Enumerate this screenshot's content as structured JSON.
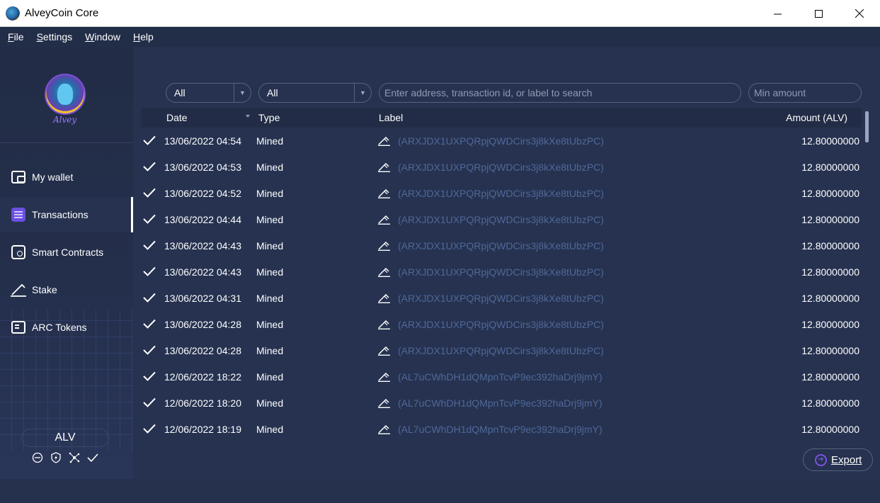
{
  "window": {
    "title": "AlveyCoin Core",
    "minimize": "—",
    "maximize": "☐",
    "close": "✕"
  },
  "menu": [
    "File",
    "Settings",
    "Window",
    "Help"
  ],
  "menu_mnemonics": [
    "F",
    "S",
    "W",
    "H"
  ],
  "sidebar": {
    "logo_text": "Alvey",
    "items": [
      {
        "label": "My wallet",
        "icon": "wallet-icon",
        "active": false
      },
      {
        "label": "Transactions",
        "icon": "transactions-icon",
        "active": true
      },
      {
        "label": "Smart Contracts",
        "icon": "smart-contracts-icon",
        "active": false
      },
      {
        "label": "Stake",
        "icon": "stake-icon",
        "active": false
      },
      {
        "label": "ARC Tokens",
        "icon": "arc-tokens-icon",
        "active": false
      }
    ],
    "unit": "ALV",
    "status_icons": [
      "hd-disabled-icon",
      "staking-icon",
      "network-icon",
      "synced-check-icon"
    ]
  },
  "filters": {
    "date_filter": "All",
    "type_filter": "All",
    "search_placeholder": "Enter address, transaction id, or label to search",
    "min_amount_placeholder": "Min amount"
  },
  "table": {
    "columns": [
      "Date",
      "Type",
      "Label",
      "Amount (ALV)"
    ],
    "rows": [
      {
        "date": "13/06/2022 04:54",
        "type": "Mined",
        "label": "(ARXJDX1UXPQRpjQWDCirs3j8kXe8tUbzPC)",
        "amount": "12.80000000"
      },
      {
        "date": "13/06/2022 04:53",
        "type": "Mined",
        "label": "(ARXJDX1UXPQRpjQWDCirs3j8kXe8tUbzPC)",
        "amount": "12.80000000"
      },
      {
        "date": "13/06/2022 04:52",
        "type": "Mined",
        "label": "(ARXJDX1UXPQRpjQWDCirs3j8kXe8tUbzPC)",
        "amount": "12.80000000"
      },
      {
        "date": "13/06/2022 04:44",
        "type": "Mined",
        "label": "(ARXJDX1UXPQRpjQWDCirs3j8kXe8tUbzPC)",
        "amount": "12.80000000"
      },
      {
        "date": "13/06/2022 04:43",
        "type": "Mined",
        "label": "(ARXJDX1UXPQRpjQWDCirs3j8kXe8tUbzPC)",
        "amount": "12.80000000"
      },
      {
        "date": "13/06/2022 04:43",
        "type": "Mined",
        "label": "(ARXJDX1UXPQRpjQWDCirs3j8kXe8tUbzPC)",
        "amount": "12.80000000"
      },
      {
        "date": "13/06/2022 04:31",
        "type": "Mined",
        "label": "(ARXJDX1UXPQRpjQWDCirs3j8kXe8tUbzPC)",
        "amount": "12.80000000"
      },
      {
        "date": "13/06/2022 04:28",
        "type": "Mined",
        "label": "(ARXJDX1UXPQRpjQWDCirs3j8kXe8tUbzPC)",
        "amount": "12.80000000"
      },
      {
        "date": "13/06/2022 04:28",
        "type": "Mined",
        "label": "(ARXJDX1UXPQRpjQWDCirs3j8kXe8tUbzPC)",
        "amount": "12.80000000"
      },
      {
        "date": "12/06/2022 18:22",
        "type": "Mined",
        "label": "(AL7uCWhDH1dQMpnTcvP9ec392haDrj9jmY)",
        "amount": "12.80000000"
      },
      {
        "date": "12/06/2022 18:20",
        "type": "Mined",
        "label": "(AL7uCWhDH1dQMpnTcvP9ec392haDrj9jmY)",
        "amount": "12.80000000"
      },
      {
        "date": "12/06/2022 18:19",
        "type": "Mined",
        "label": "(AL7uCWhDH1dQMpnTcvP9ec392haDrj9jmY)",
        "amount": "12.80000000"
      }
    ]
  },
  "export": {
    "label": "Export",
    "icon": "export-arrow-icon"
  },
  "colors": {
    "accent": "#7a52e0",
    "label_text": "#4f6898",
    "background": "#263250",
    "sidebar": "#222c46"
  }
}
